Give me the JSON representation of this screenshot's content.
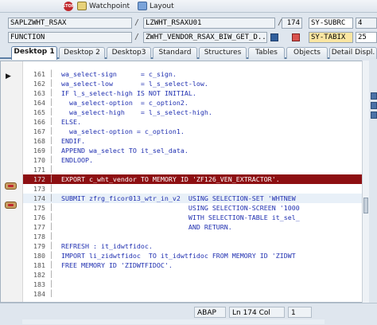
{
  "toolbar": {
    "watchpoint": "Watchpoint",
    "layout": "Layout",
    "stop_icon_text": "STOP"
  },
  "fields": {
    "program": "SAPLZWHT_RSAX",
    "include": "LZWHT_RSAXU01",
    "line_no": "174",
    "var1_name": "SY-SUBRC",
    "var1_value": "4",
    "kind": "FUNCTION",
    "event": "ZWHT_VENDOR_RSAX_BIW_GET_D...",
    "var2_name": "SY-TABIX",
    "var2_value": "25"
  },
  "tabs": [
    {
      "label": "Desktop 1",
      "active": true
    },
    {
      "label": "Desktop 2"
    },
    {
      "label": "Desktop3"
    },
    {
      "label": "Standard"
    },
    {
      "label": "Structures"
    },
    {
      "label": "Tables"
    },
    {
      "label": "Objects"
    },
    {
      "label": "Detail Displ."
    }
  ],
  "editor": {
    "lines": [
      {
        "num": "161",
        "code": "wa_select-sign      = c_sign."
      },
      {
        "num": "162",
        "code": "wa_select-low       = l_s_select-low."
      },
      {
        "num": "163",
        "code": "IF l_s_select-high IS NOT INITIAL."
      },
      {
        "num": "164",
        "code": "  wa_select-option  = c_option2."
      },
      {
        "num": "165",
        "code": "  wa_select-high    = l_s_select-high."
      },
      {
        "num": "166",
        "code": "ELSE."
      },
      {
        "num": "167",
        "code": "  wa_select-option = c_option1."
      },
      {
        "num": "168",
        "code": "ENDIF."
      },
      {
        "num": "169",
        "code": "APPEND wa_select TO it_sel_data."
      },
      {
        "num": "170",
        "code": "ENDLOOP."
      },
      {
        "num": "171",
        "code": ""
      },
      {
        "num": "172",
        "code": "EXPORT c_wht_vendor TO MEMORY ID 'ZF126_VEN_EXTRACTOR'."
      },
      {
        "num": "173",
        "code": ""
      },
      {
        "num": "174",
        "code": "SUBMIT zfrg_ficor013_wtr_in_v2  USING SELECTION-SET 'WHTNEW"
      },
      {
        "num": "175",
        "code": "                                USING SELECTION-SCREEN '1000"
      },
      {
        "num": "176",
        "code": "                                WITH SELECTION-TABLE it_sel_"
      },
      {
        "num": "177",
        "code": "                                AND RETURN."
      },
      {
        "num": "178",
        "code": ""
      },
      {
        "num": "179",
        "code": "REFRESH : it_idwtfidoc."
      },
      {
        "num": "180",
        "code": "IMPORT li_zidwtfidoc  TO it_idwtfidoc FROM MEMORY ID 'ZIDWT"
      },
      {
        "num": "181",
        "code": "FREE MEMORY ID 'ZIDWTFIDOC'."
      },
      {
        "num": "182",
        "code": ""
      },
      {
        "num": "183",
        "code": ""
      },
      {
        "num": "184",
        "code": ""
      }
    ]
  },
  "status": {
    "lang": "ABAP",
    "pos": "Ln 174 Col",
    "col_value": "1"
  }
}
